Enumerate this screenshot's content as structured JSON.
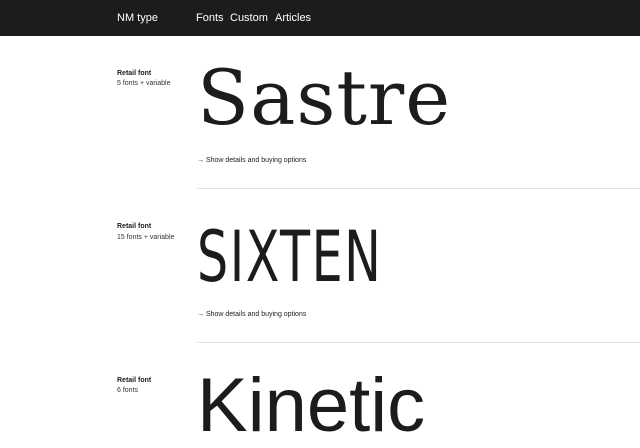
{
  "header": {
    "brand": "NM type",
    "nav": [
      {
        "label": "Fonts"
      },
      {
        "label": "Custom"
      },
      {
        "label": "Articles"
      }
    ]
  },
  "fonts": [
    {
      "category": "Retail font",
      "count": "5 fonts + variable",
      "name": "Sastre",
      "link": "→ Show details and buying options"
    },
    {
      "category": "Retail font",
      "count": "15 fonts + variable",
      "name": "SIXTEN",
      "link": "→ Show details and buying options"
    },
    {
      "category": "Retail font",
      "count": "6 fonts",
      "name": "Kinetic"
    }
  ]
}
